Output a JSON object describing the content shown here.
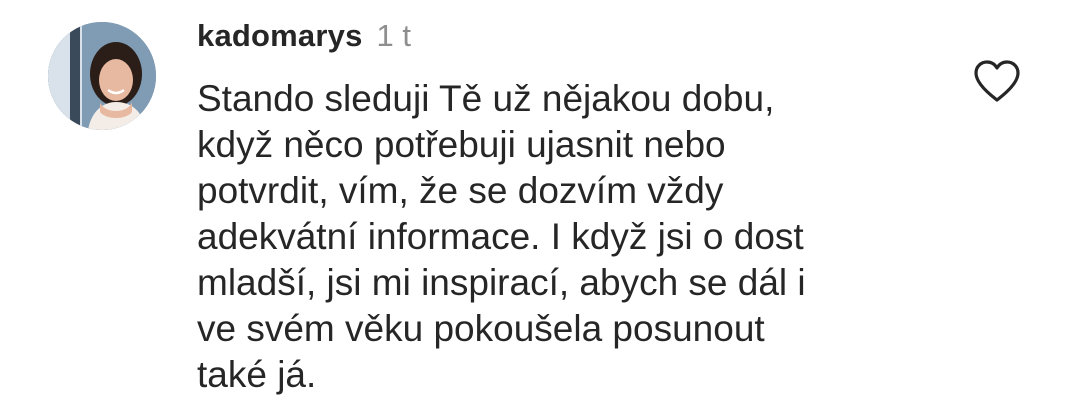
{
  "comment": {
    "username": "kadomarys",
    "timestamp": "1 t",
    "text": "Stando sleduji Tě už nějakou dobu,\nkdyž něco potřebuji ujasnit nebo\npotvrdit, vím, že se dozvím vždy\nadekvátní informace. I když jsi o dost\nmladší, jsi mi inspirací, abych se  dál i\nve svém věku pokoušela posunout\ntaké já.",
    "avatar_icon": "profile-photo",
    "like_icon": "heart-outline-icon"
  },
  "colors": {
    "text": "#262626",
    "secondary_text": "#8e8e8e",
    "icon_stroke": "#262626",
    "background": "#ffffff"
  }
}
